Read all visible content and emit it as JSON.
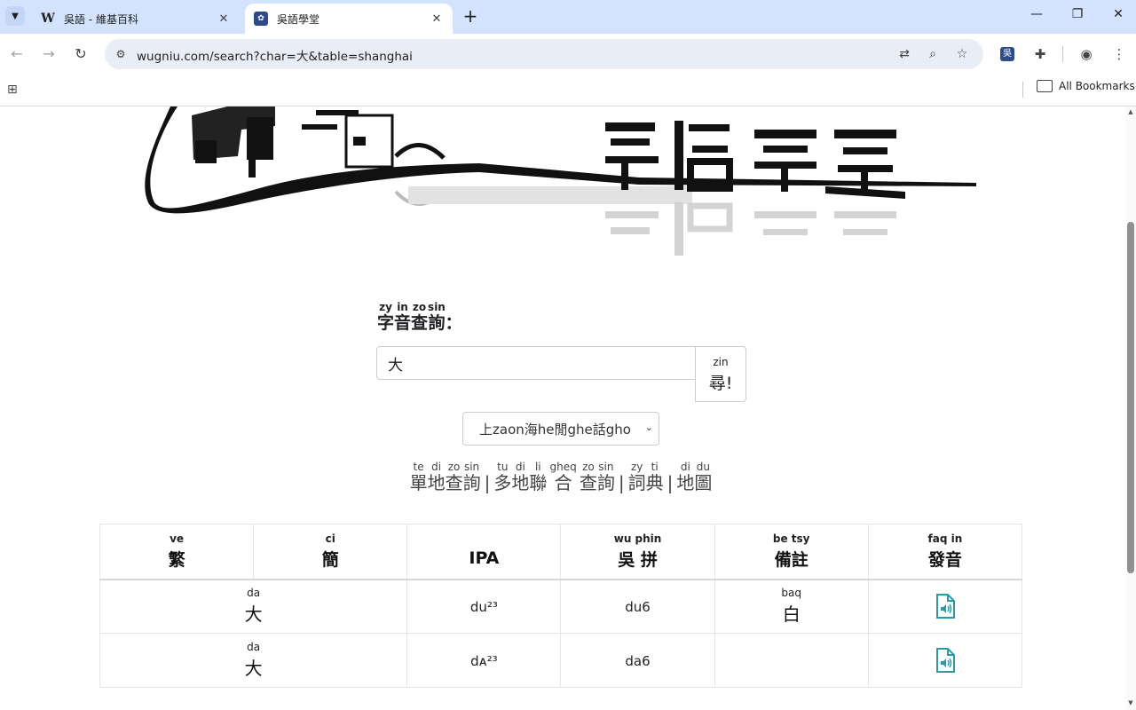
{
  "browser": {
    "tabs": [
      {
        "title": "吳語 - 維基百科",
        "favicon": "wikipedia-icon"
      },
      {
        "title": "吳語學堂",
        "favicon": "wugniu-icon"
      }
    ],
    "url": "wugniu.com/search?char=大&table=shanghai",
    "bookmarks_label": "All Bookmarks",
    "ext_label": "吳"
  },
  "search": {
    "label_ruby": [
      "zy",
      "in",
      "zo",
      "sin"
    ],
    "label_chars": [
      "字",
      "音",
      "查",
      "詢"
    ],
    "label_colon": "：",
    "value": "大",
    "button_ann": "zin",
    "button_label": "尋!"
  },
  "table_select": {
    "selected": "上zaon海he閒ghe話gho"
  },
  "modes": [
    {
      "chars": [
        "單",
        "地",
        "查",
        "詢"
      ],
      "ruby": [
        "te",
        "di",
        "zo",
        "sin"
      ]
    },
    {
      "chars": [
        "多",
        "地",
        "聯",
        "合",
        "查",
        "詢"
      ],
      "ruby": [
        "tu",
        "di",
        "li",
        "gheq",
        "zo",
        "sin"
      ]
    },
    {
      "chars": [
        "詞",
        "典"
      ],
      "ruby": [
        "zy",
        "ti"
      ]
    },
    {
      "chars": [
        "地",
        "圖"
      ],
      "ruby": [
        "di",
        "du"
      ]
    }
  ],
  "results": {
    "headers": [
      {
        "ann": "ve",
        "label": "繁"
      },
      {
        "ann": "ci",
        "label": "簡"
      },
      {
        "ann": "",
        "label": "IPA"
      },
      {
        "ann": "wu phin",
        "label": "吳 拼"
      },
      {
        "ann": "be tsy",
        "label": "備註"
      },
      {
        "ann": "faq  in",
        "label": "發音"
      }
    ],
    "rows": [
      {
        "char_ann": "da",
        "char": "大",
        "ipa": "du²³",
        "wupin": "du6",
        "note_ann": "baq",
        "note": "白"
      },
      {
        "char_ann": "da",
        "char": "大",
        "ipa": "dᴀ²³",
        "wupin": "da6",
        "note_ann": "",
        "note": ""
      }
    ]
  },
  "colors": {
    "accent": "#2a9aa8",
    "tabstrip": "#d3e3fd",
    "omnibox": "#e9eef6"
  }
}
